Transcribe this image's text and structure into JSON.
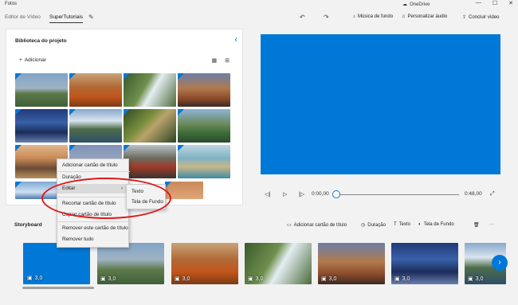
{
  "window": {
    "title": "Fotos",
    "onedrive": "OneDrive",
    "min": "—",
    "max": "☐",
    "close": "✕"
  },
  "toolbar": {
    "crumb_editor": "Editor de Vídeo",
    "crumb_project": "SuperTutoriais",
    "music": "Música de fundo",
    "audio": "Personalizar áudio",
    "finish": "Concluir vídeo"
  },
  "library": {
    "title": "Biblioteca do projeto",
    "add": "Adicionar"
  },
  "player": {
    "current": "0:00,00",
    "total": "0:48,00"
  },
  "storyboard": {
    "title": "Storyboard",
    "add_title_card": "Adicionar cartão de título",
    "duration": "Duração",
    "text": "Texto",
    "background": "Tela de Fundo",
    "more": "···",
    "clip_duration": "3,0"
  },
  "context_menu": {
    "items": [
      "Adicionar cartão de título",
      "Duração",
      "Editar",
      "Recortar cartão de título",
      "Copiar cartão de título",
      "Remover este cartão de título",
      "Remover tudo"
    ],
    "submenu": [
      "Texto",
      "Tela de Fundo"
    ]
  },
  "colors": {
    "accent": "#0078d7",
    "annotation": "#e01919"
  },
  "icons": [
    "pencil-icon",
    "undo-icon",
    "redo-icon",
    "music-icon",
    "audio-icon",
    "export-icon",
    "chevron-left-icon",
    "plus-icon",
    "grid-small-icon",
    "grid-large-icon",
    "prev-frame-icon",
    "play-icon",
    "next-frame-icon",
    "fullscreen-icon",
    "title-card-icon",
    "clock-icon",
    "text-icon",
    "palette-icon",
    "trash-icon",
    "image-icon",
    "chevron-right-icon",
    "cloud-icon"
  ]
}
